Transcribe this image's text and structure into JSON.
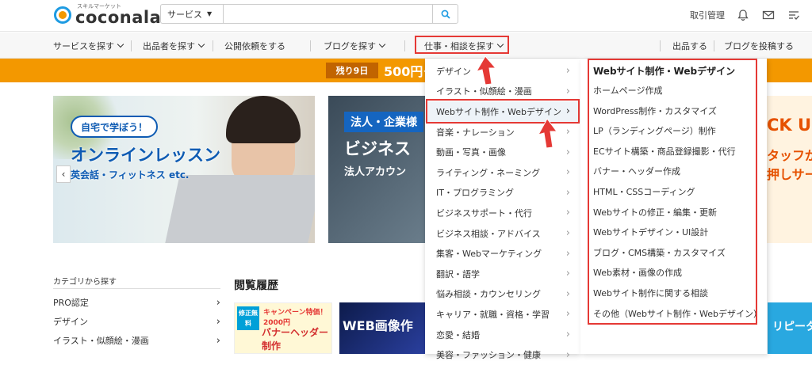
{
  "header": {
    "logo_sub": "スキルマーケット",
    "logo_main": "coconala",
    "search_category": "サービス",
    "search_placeholder": "",
    "links": [
      "取引管理"
    ]
  },
  "nav": {
    "items": [
      "サービスを探す",
      "出品者を探す",
      "公開依頼をする",
      "ブログを探す",
      "仕事・相談を探す"
    ],
    "right_items": [
      "出品する",
      "ブログを投稿する"
    ]
  },
  "banner": {
    "tag": "残り9日",
    "text": "500円ク"
  },
  "hero": {
    "slide1_pill": "自宅で学ぼう！",
    "slide1_title": "オンラインレッスン",
    "slide1_sub": "英会話・フィットネス etc.",
    "slide2_tag": "法人・企業様",
    "slide2_title": "ビジネス",
    "slide2_sub": "法人アカウン",
    "slide3_t1": "CK U",
    "slide3_t2": "タッフが",
    "slide3_t3": "押しサー"
  },
  "sidebar": {
    "title": "カテゴリから探す",
    "items": [
      "PRO認定",
      "デザイン",
      "イラスト・似顔絵・漫画"
    ]
  },
  "history": {
    "title": "閲覧履歴",
    "thumb1_ribbon": "修正無料",
    "thumb1_campaign": "キャンペーン特価！2000円",
    "thumb1_big": "バナーヘッダー制作",
    "thumb2_big": "WEB画像作",
    "thumb3_big": "リピータ"
  },
  "menu_level1": {
    "items": [
      "デザイン",
      "イラスト・似顔絵・漫画",
      "Webサイト制作・Webデザイン",
      "音楽・ナレーション",
      "動画・写真・画像",
      "ライティング・ネーミング",
      "IT・プログラミング",
      "ビジネスサポート・代行",
      "ビジネス相談・アドバイス",
      "集客・Webマーケティング",
      "翻訳・語学",
      "悩み相談・カウンセリング",
      "キャリア・就職・資格・学習",
      "恋愛・結婚",
      "美容・ファッション・健康"
    ],
    "active_index": 2
  },
  "menu_level2": {
    "title": "Webサイト制作・Webデザイン",
    "items": [
      "ホームページ作成",
      "WordPress制作・カスタマイズ",
      "LP（ランディングページ）制作",
      "ECサイト構築・商品登録撮影・代行",
      "バナー・ヘッダー作成",
      "HTML・CSSコーディング",
      "Webサイトの修正・編集・更新",
      "Webサイトデザイン・UI設計",
      "ブログ・CMS構築・カスタマイズ",
      "Web素材・画像の作成",
      "Webサイト制作に関する相談",
      "その他（Webサイト制作・Webデザイン）"
    ]
  },
  "colors": {
    "accent": "#f39800",
    "brand_blue": "#1e9be2",
    "highlight_red": "#e53935"
  }
}
